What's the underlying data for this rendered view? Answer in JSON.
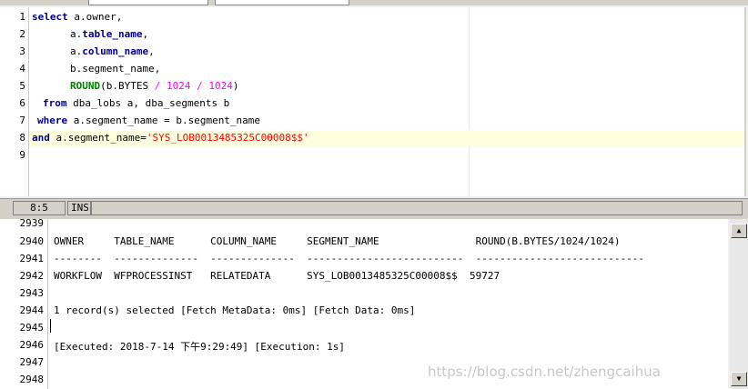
{
  "editor": {
    "lines": [
      "1",
      "2",
      "3",
      "4",
      "5",
      "6",
      "7",
      "8",
      "9"
    ],
    "code": {
      "l1_kw": "select",
      "l1_rest": " a.owner,",
      "l2_a": "a.",
      "l2_col": "table_name",
      "l2_end": ",",
      "l3_a": "a.",
      "l3_col": "column_name",
      "l3_end": ",",
      "l4": "b.segment_name,",
      "l5_fn": "ROUND",
      "l5_a": "(b.BYTES ",
      "l5_op1": "/",
      "l5_n1": " 1024 ",
      "l5_op2": "/",
      "l5_n2": " 1024",
      "l5_end": ")",
      "l6_kw": "from",
      "l6_rest": " dba_lobs a, dba_segments b",
      "l7_kw": "where",
      "l7_rest": " a.segment_name = b.segment_name",
      "l8_kw": "and",
      "l8_rest": " a.segment_name=",
      "l8_str": "'SYS_LOB0013485325C00008$$'"
    }
  },
  "status": {
    "position": "8:5",
    "mode": "INS"
  },
  "output": {
    "lines": [
      "2939",
      "2940",
      "2941",
      "2942",
      "2943",
      "2944",
      "2945",
      "2946",
      "2947",
      "2948"
    ],
    "text": {
      "r2940": "OWNER     TABLE_NAME      COLUMN_NAME     SEGMENT_NAME                ROUND(B.BYTES/1024/1024)",
      "r2941": "--------  --------------  --------------  --------------------------  ----------------------------",
      "r2942": "WORKFLOW  WFPROCESSINST   RELATEDATA      SYS_LOB0013485325C00008$$  59727",
      "r2944": "1 record(s) selected [Fetch MetaData: 0ms] [Fetch Data: 0ms]",
      "r2946": "[Executed: 2018-7-14 下午9:29:49] [Execution: 1s]"
    }
  },
  "watermark": "https://blog.csdn.net/zhengcaihua"
}
